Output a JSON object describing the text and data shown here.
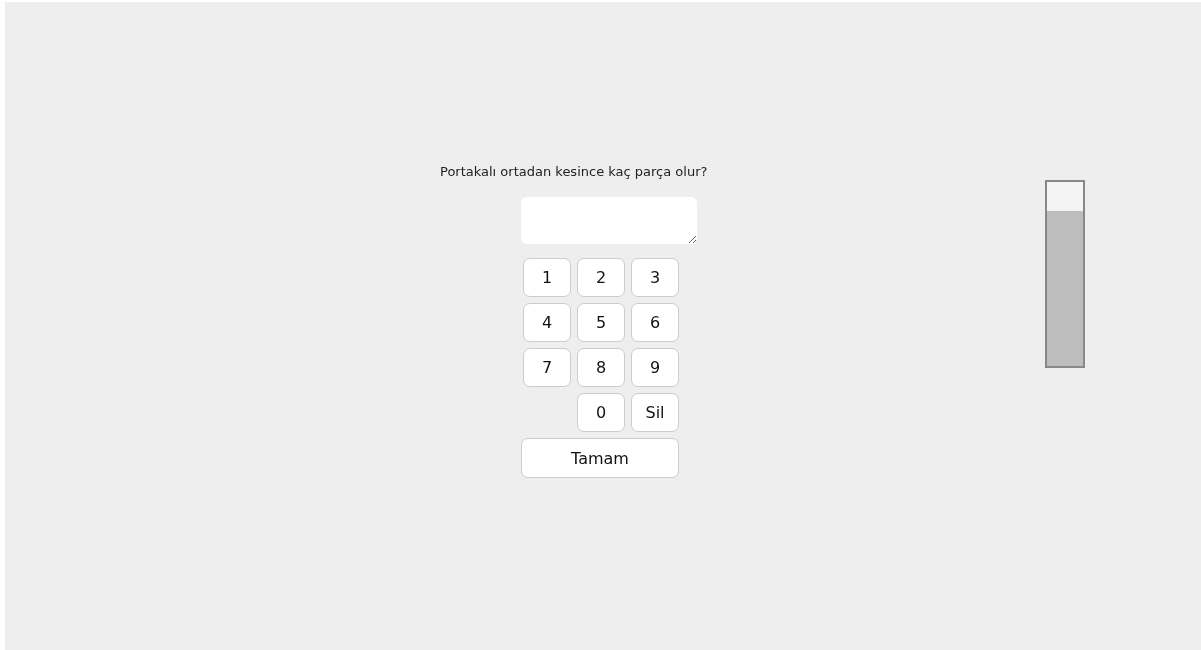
{
  "question": "Portakalı ortadan kesince kaç parça olur?",
  "keypad": [
    {
      "keys": [
        "1",
        "2",
        "3"
      ]
    },
    {
      "keys": [
        "4",
        "5",
        "6"
      ]
    },
    {
      "keys": [
        "7",
        "8",
        "9"
      ]
    },
    {
      "keys": [
        "0",
        "Sil"
      ]
    }
  ],
  "submit_button": "Tamam",
  "meter": {
    "level": 0.84
  }
}
